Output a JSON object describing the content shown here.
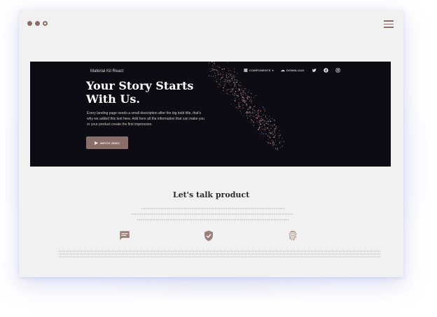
{
  "window": {
    "controls": [
      "dot",
      "dot",
      "gear-icon"
    ],
    "menu_icon": "hamburger-icon"
  },
  "hero": {
    "brand": "Material Kit React",
    "nav": {
      "components_label": "COMPONENTS",
      "download_label": "DOWNLOAD",
      "social_icons": [
        "twitter-icon",
        "facebook-icon",
        "instagram-icon"
      ]
    },
    "title_line1": "Your Story Starts",
    "title_line2": "With Us.",
    "description": "Every landing page needs a small description after the big bold title, that's why we added this text here. Add here all the information that can make you or your product create the first impression.",
    "cta_label": "WATCH VIDEO"
  },
  "product": {
    "title": "Let's talk product",
    "features": [
      "chat-icon",
      "verified-shield-icon",
      "fingerprint-icon"
    ]
  },
  "colors": {
    "accent": "#8a6e6a",
    "hero_bg": "#0d0c14",
    "window_bg": "#f1f1f1"
  }
}
